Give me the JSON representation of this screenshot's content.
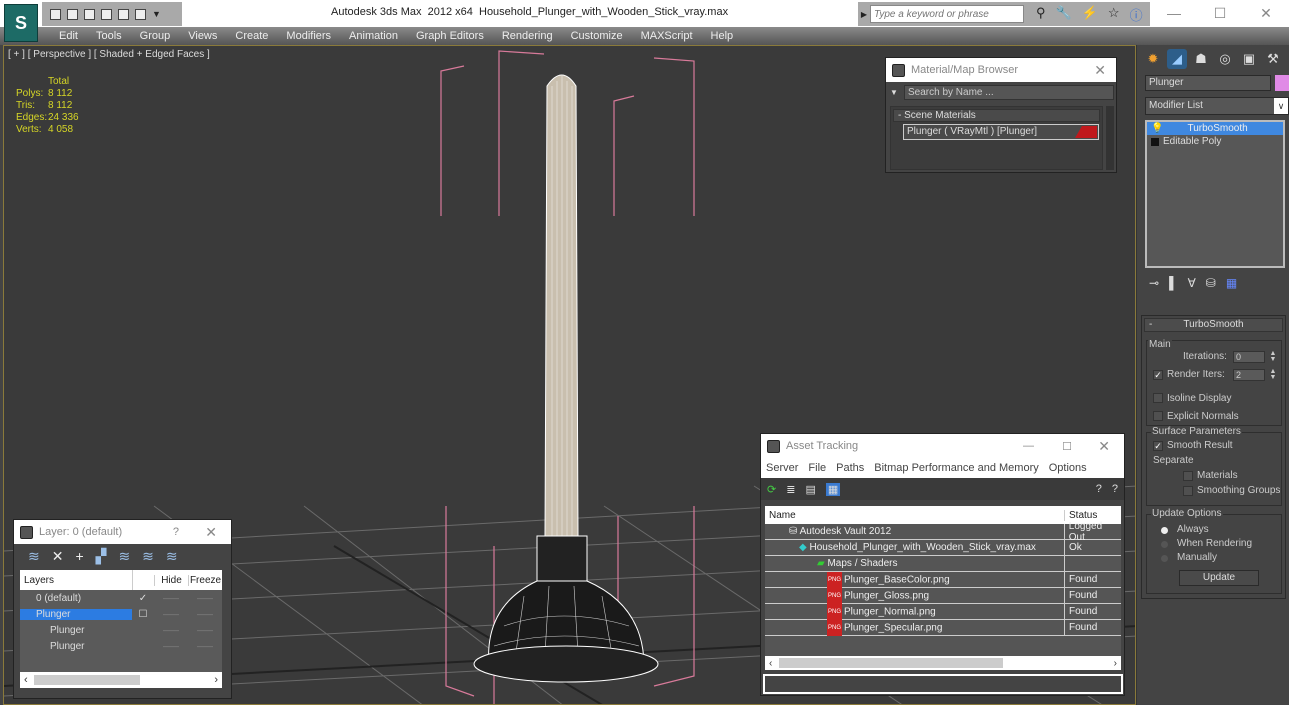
{
  "window": {
    "title": "Autodesk 3ds Max  2012 x64",
    "file": "Household_Plunger_with_Wooden_Stick_vray.max",
    "search_placeholder": "Type a keyword or phrase",
    "controls": {
      "minimize": "—",
      "maximize": "☐",
      "close": "✕"
    }
  },
  "menu": [
    "Edit",
    "Tools",
    "Group",
    "Views",
    "Create",
    "Modifiers",
    "Animation",
    "Graph Editors",
    "Rendering",
    "Customize",
    "MAXScript",
    "Help"
  ],
  "viewport": {
    "label": "[ + ] [ Perspective ] [ Shaded + Edged Faces ]",
    "stats": {
      "header": "Total",
      "rows": [
        {
          "k": "Polys:",
          "v": "8 112"
        },
        {
          "k": "Tris:",
          "v": "8 112"
        },
        {
          "k": "Edges:",
          "v": "24 336"
        },
        {
          "k": "Verts:",
          "v": "4 058"
        }
      ]
    }
  },
  "command_panel": {
    "object_name": "Plunger",
    "object_color": "#e08ae6",
    "modifier_list": "Modifier List",
    "stack": [
      {
        "label": "TurboSmooth",
        "selected": true
      },
      {
        "label": "Editable Poly",
        "selected": false
      }
    ],
    "turbosmooth": {
      "title": "TurboSmooth",
      "main": "Main",
      "iterations_label": "Iterations:",
      "iterations": "0",
      "render_iters_label": "Render Iters:",
      "render_iters": "2",
      "render_iters_checked": true,
      "isoline": "Isoline Display",
      "explicit": "Explicit Normals",
      "surface": "Surface Parameters",
      "smooth_result": "Smooth Result",
      "separate": "Separate",
      "materials": "Materials",
      "smoothing_groups": "Smoothing Groups",
      "update_options": "Update Options",
      "always": "Always",
      "when_rendering": "When Rendering",
      "manually": "Manually",
      "update_button": "Update"
    }
  },
  "material_browser": {
    "title": "Material/Map Browser",
    "search": "Search by Name ...",
    "section": "- Scene Materials",
    "material": "Plunger  ( VRayMtl ) [Plunger]"
  },
  "layer_dialog": {
    "title": "Layer: 0 (default)",
    "help": "?",
    "columns": {
      "layers": "Layers",
      "hide": "Hide",
      "freeze": "Freeze"
    },
    "rows": [
      {
        "name": "0 (default)",
        "current": "✓"
      },
      {
        "name": "Plunger",
        "current": "☐"
      },
      {
        "name": "Plunger",
        "current": ""
      },
      {
        "name": "Plunger",
        "current": ""
      }
    ],
    "dash": "——"
  },
  "asset_tracking": {
    "title": "Asset Tracking",
    "menu": [
      "Server",
      "File",
      "Paths",
      "Bitmap Performance and Memory",
      "Options"
    ],
    "columns": {
      "name": "Name",
      "status": "Status"
    },
    "rows": [
      {
        "name": "Autodesk Vault 2012",
        "status": "Logged Out"
      },
      {
        "name": "Household_Plunger_with_Wooden_Stick_vray.max",
        "status": "Ok"
      },
      {
        "name": "Maps / Shaders",
        "status": ""
      },
      {
        "name": "Plunger_BaseColor.png",
        "status": "Found"
      },
      {
        "name": "Plunger_Gloss.png",
        "status": "Found"
      },
      {
        "name": "Plunger_Normal.png",
        "status": "Found"
      },
      {
        "name": "Plunger_Specular.png",
        "status": "Found"
      }
    ],
    "png_tag": "PNG"
  }
}
